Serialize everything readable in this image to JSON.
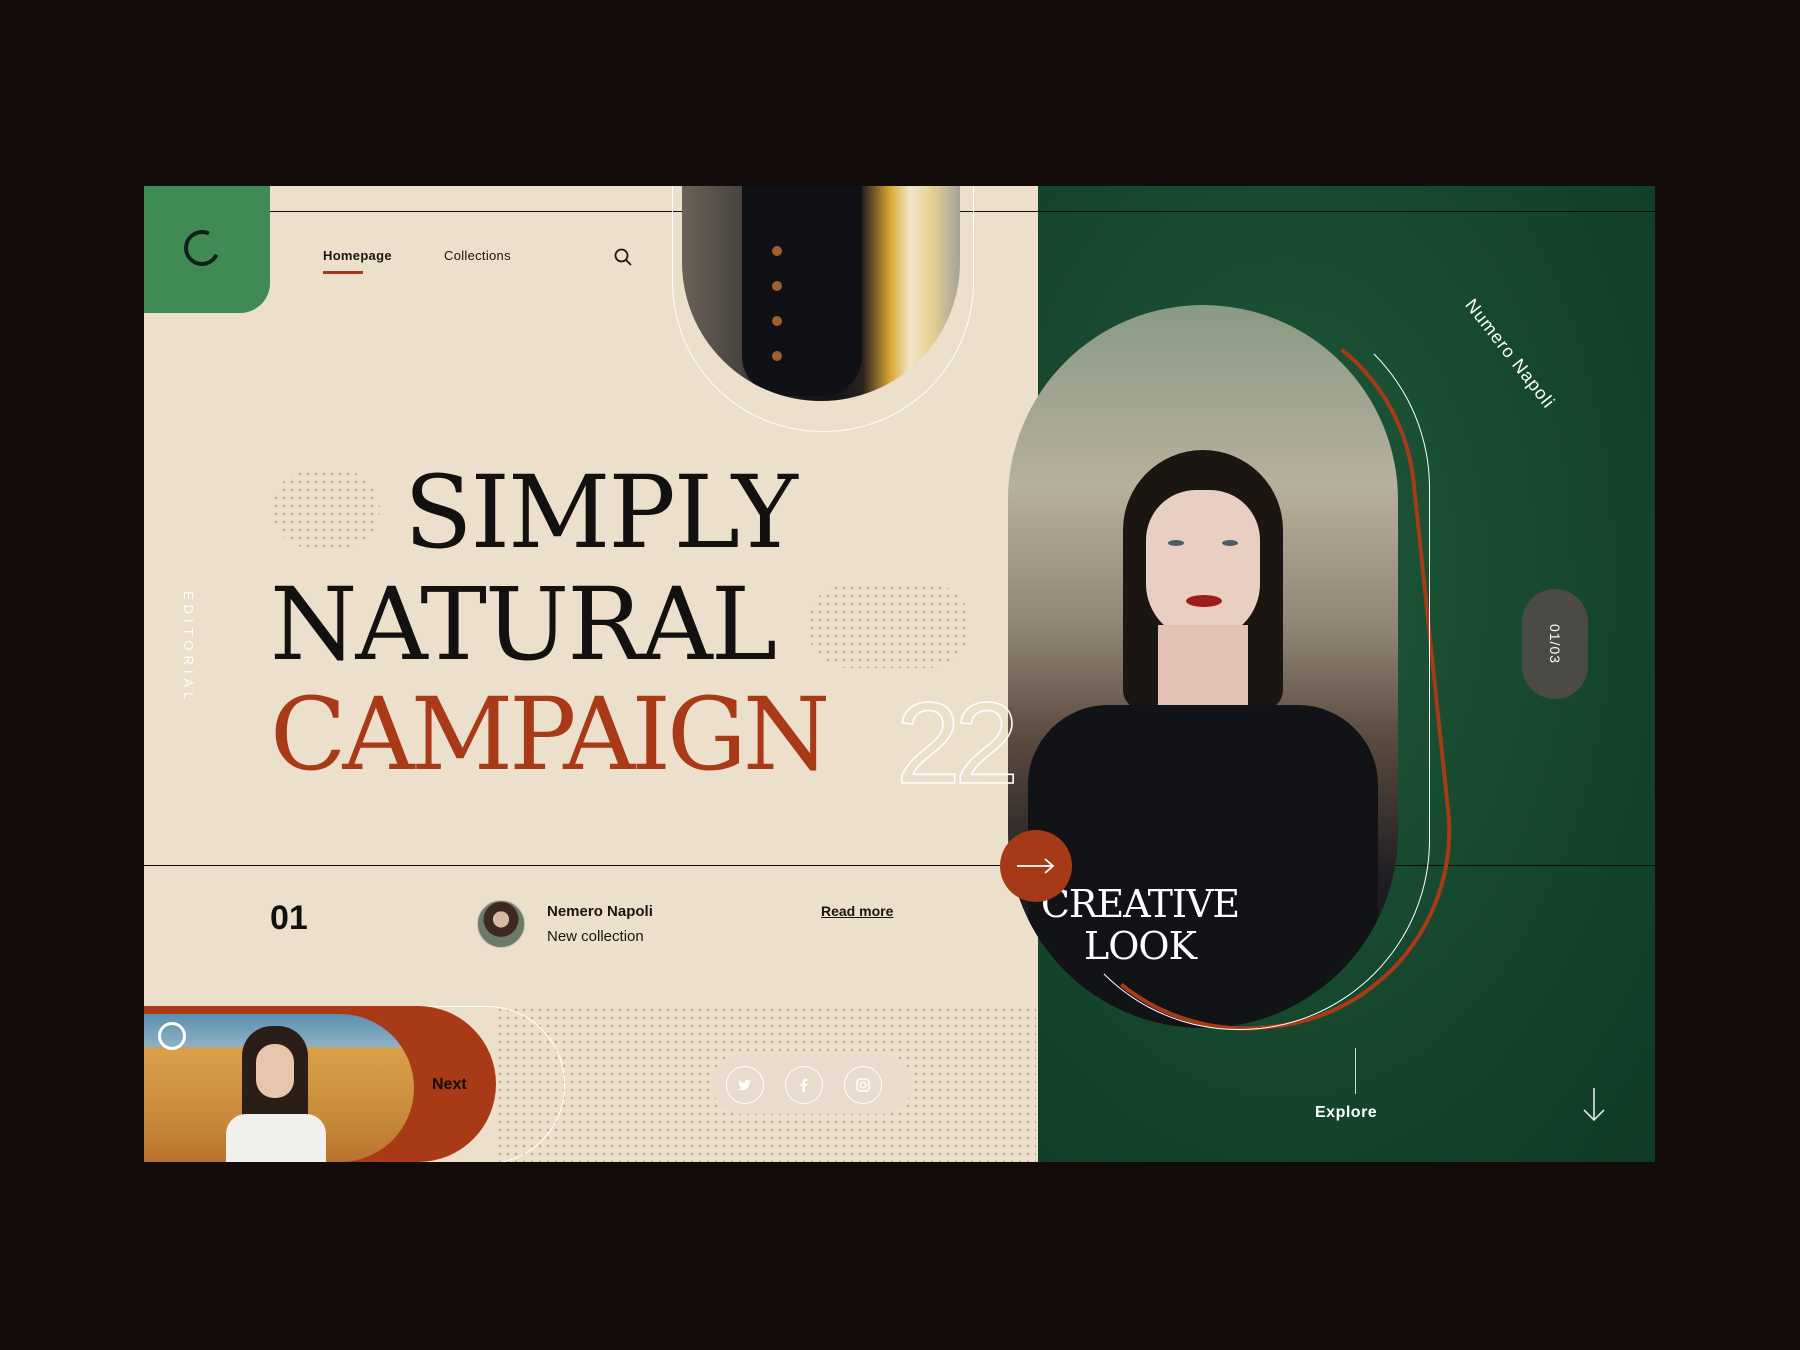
{
  "brand": {
    "logo_letter": "C"
  },
  "nav": {
    "items": [
      {
        "label": "Homepage",
        "active": true
      },
      {
        "label": "Collections",
        "active": false
      }
    ],
    "search_icon": "search-icon"
  },
  "hero": {
    "line1": "SIMPLY",
    "line2": "NATURAL",
    "line3": "CAMPAIGN",
    "number": "22",
    "side_label": "EDITORIAL",
    "colors": {
      "accent": "#a83a17",
      "dark": "#131110",
      "cream": "#ecdfcb",
      "green": "#3f8a55"
    }
  },
  "feature": {
    "index": "01",
    "author_name": "Nemero Napoli",
    "author_subtitle": "New collection",
    "read_more": "Read more"
  },
  "next": {
    "label": "Next"
  },
  "social": [
    "twitter-icon",
    "facebook-icon",
    "instagram-icon"
  ],
  "right_panel": {
    "brand_curve": "Numero Napoli",
    "counter": "01/03",
    "caption_line1": "CREATIVE",
    "caption_line2": "LOOK",
    "explore_label": "Explore",
    "colors": {
      "panel": "#174a30"
    }
  }
}
